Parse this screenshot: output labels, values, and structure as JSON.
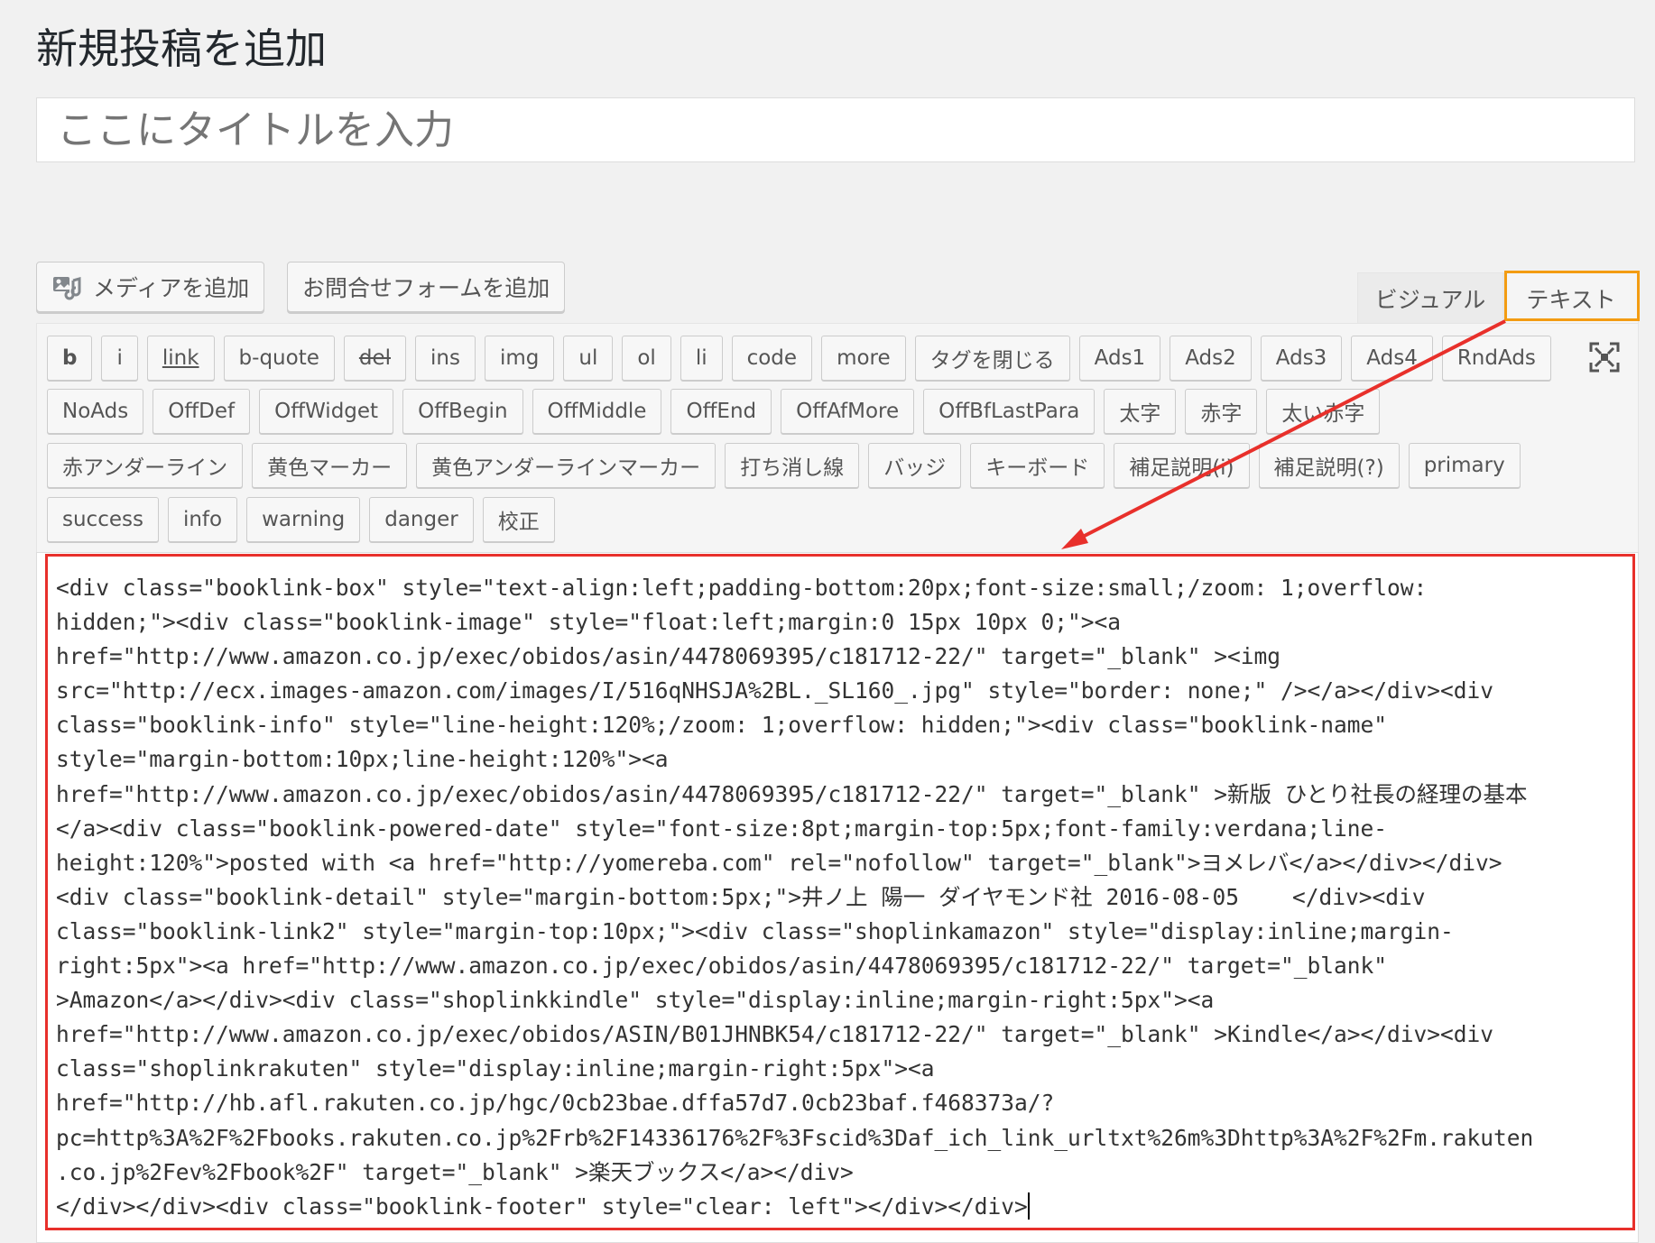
{
  "page": {
    "title": "新規投稿を追加",
    "title_placeholder": "ここにタイトルを入力"
  },
  "media_buttons": {
    "add_media": "メディアを追加",
    "add_contact_form": "お問合せフォームを追加"
  },
  "editor_tabs": {
    "visual": "ビジュアル",
    "text": "テキスト",
    "active": "text"
  },
  "quicktags": {
    "row1": [
      "b",
      "i",
      "link",
      "b-quote",
      "del",
      "ins",
      "img",
      "ul",
      "ol",
      "li",
      "code",
      "more",
      "タグを閉じる",
      "Ads1",
      "Ads2",
      "Ads3",
      "Ads4",
      "RndAds"
    ],
    "row2": [
      "NoAds",
      "OffDef",
      "OffWidget",
      "OffBegin",
      "OffMiddle",
      "OffEnd",
      "OffAfMore",
      "OffBfLastPara",
      "太字",
      "赤字",
      "太い赤字"
    ],
    "row3": [
      "赤アンダーライン",
      "黄色マーカー",
      "黄色アンダーラインマーカー",
      "打ち消し線",
      "バッジ",
      "キーボード",
      "補足説明(i)",
      "補足説明(?)",
      "primary"
    ],
    "row4": [
      "success",
      "info",
      "warning",
      "danger",
      "校正"
    ]
  },
  "content_lines": [
    "<div class=\"booklink-box\" style=\"text-align:left;padding-bottom:20px;font-size:small;/zoom: 1;overflow:",
    "hidden;\"><div class=\"booklink-image\" style=\"float:left;margin:0 15px 10px 0;\"><a",
    "href=\"http://www.amazon.co.jp/exec/obidos/asin/4478069395/c181712-22/\" target=\"_blank\" ><img",
    "src=\"http://ecx.images-amazon.com/images/I/516qNHSJA%2BL._SL160_.jpg\" style=\"border: none;\" /></a></div><div",
    "class=\"booklink-info\" style=\"line-height:120%;/zoom: 1;overflow: hidden;\"><div class=\"booklink-name\"",
    "style=\"margin-bottom:10px;line-height:120%\"><a",
    "href=\"http://www.amazon.co.jp/exec/obidos/asin/4478069395/c181712-22/\" target=\"_blank\" >新版 ひとり社長の経理の基本",
    "</a><div class=\"booklink-powered-date\" style=\"font-size:8pt;margin-top:5px;font-family:verdana;line-",
    "height:120%\">posted with <a href=\"http://yomereba.com\" rel=\"nofollow\" target=\"_blank\">ヨメレバ</a></div></div>",
    "<div class=\"booklink-detail\" style=\"margin-bottom:5px;\">井ノ上 陽一 ダイヤモンド社 2016-08-05    </div><div",
    "class=\"booklink-link2\" style=\"margin-top:10px;\"><div class=\"shoplinkamazon\" style=\"display:inline;margin-",
    "right:5px\"><a href=\"http://www.amazon.co.jp/exec/obidos/asin/4478069395/c181712-22/\" target=\"_blank\"",
    ">Amazon</a></div><div class=\"shoplinkkindle\" style=\"display:inline;margin-right:5px\"><a",
    "href=\"http://www.amazon.co.jp/exec/obidos/ASIN/B01JHNBK54/c181712-22/\" target=\"_blank\" >Kindle</a></div><div",
    "class=\"shoplinkrakuten\" style=\"display:inline;margin-right:5px\"><a",
    "href=\"http://hb.afl.rakuten.co.jp/hgc/0cb23bae.dffa57d7.0cb23baf.f468373a/?",
    "pc=http%3A%2F%2Fbooks.rakuten.co.jp%2Frb%2F14336176%2F%3Fscid%3Daf_ich_link_urltxt%26m%3Dhttp%3A%2F%2Fm.rakuten",
    ".co.jp%2Fev%2Fbook%2F\" target=\"_blank\" >楽天ブックス</a></div>",
    "</div></div><div class=\"booklink-footer\" style=\"clear: left\"></div></div>"
  ],
  "colors": {
    "highlight_orange": "#f39c12",
    "highlight_red": "#e8302b"
  }
}
